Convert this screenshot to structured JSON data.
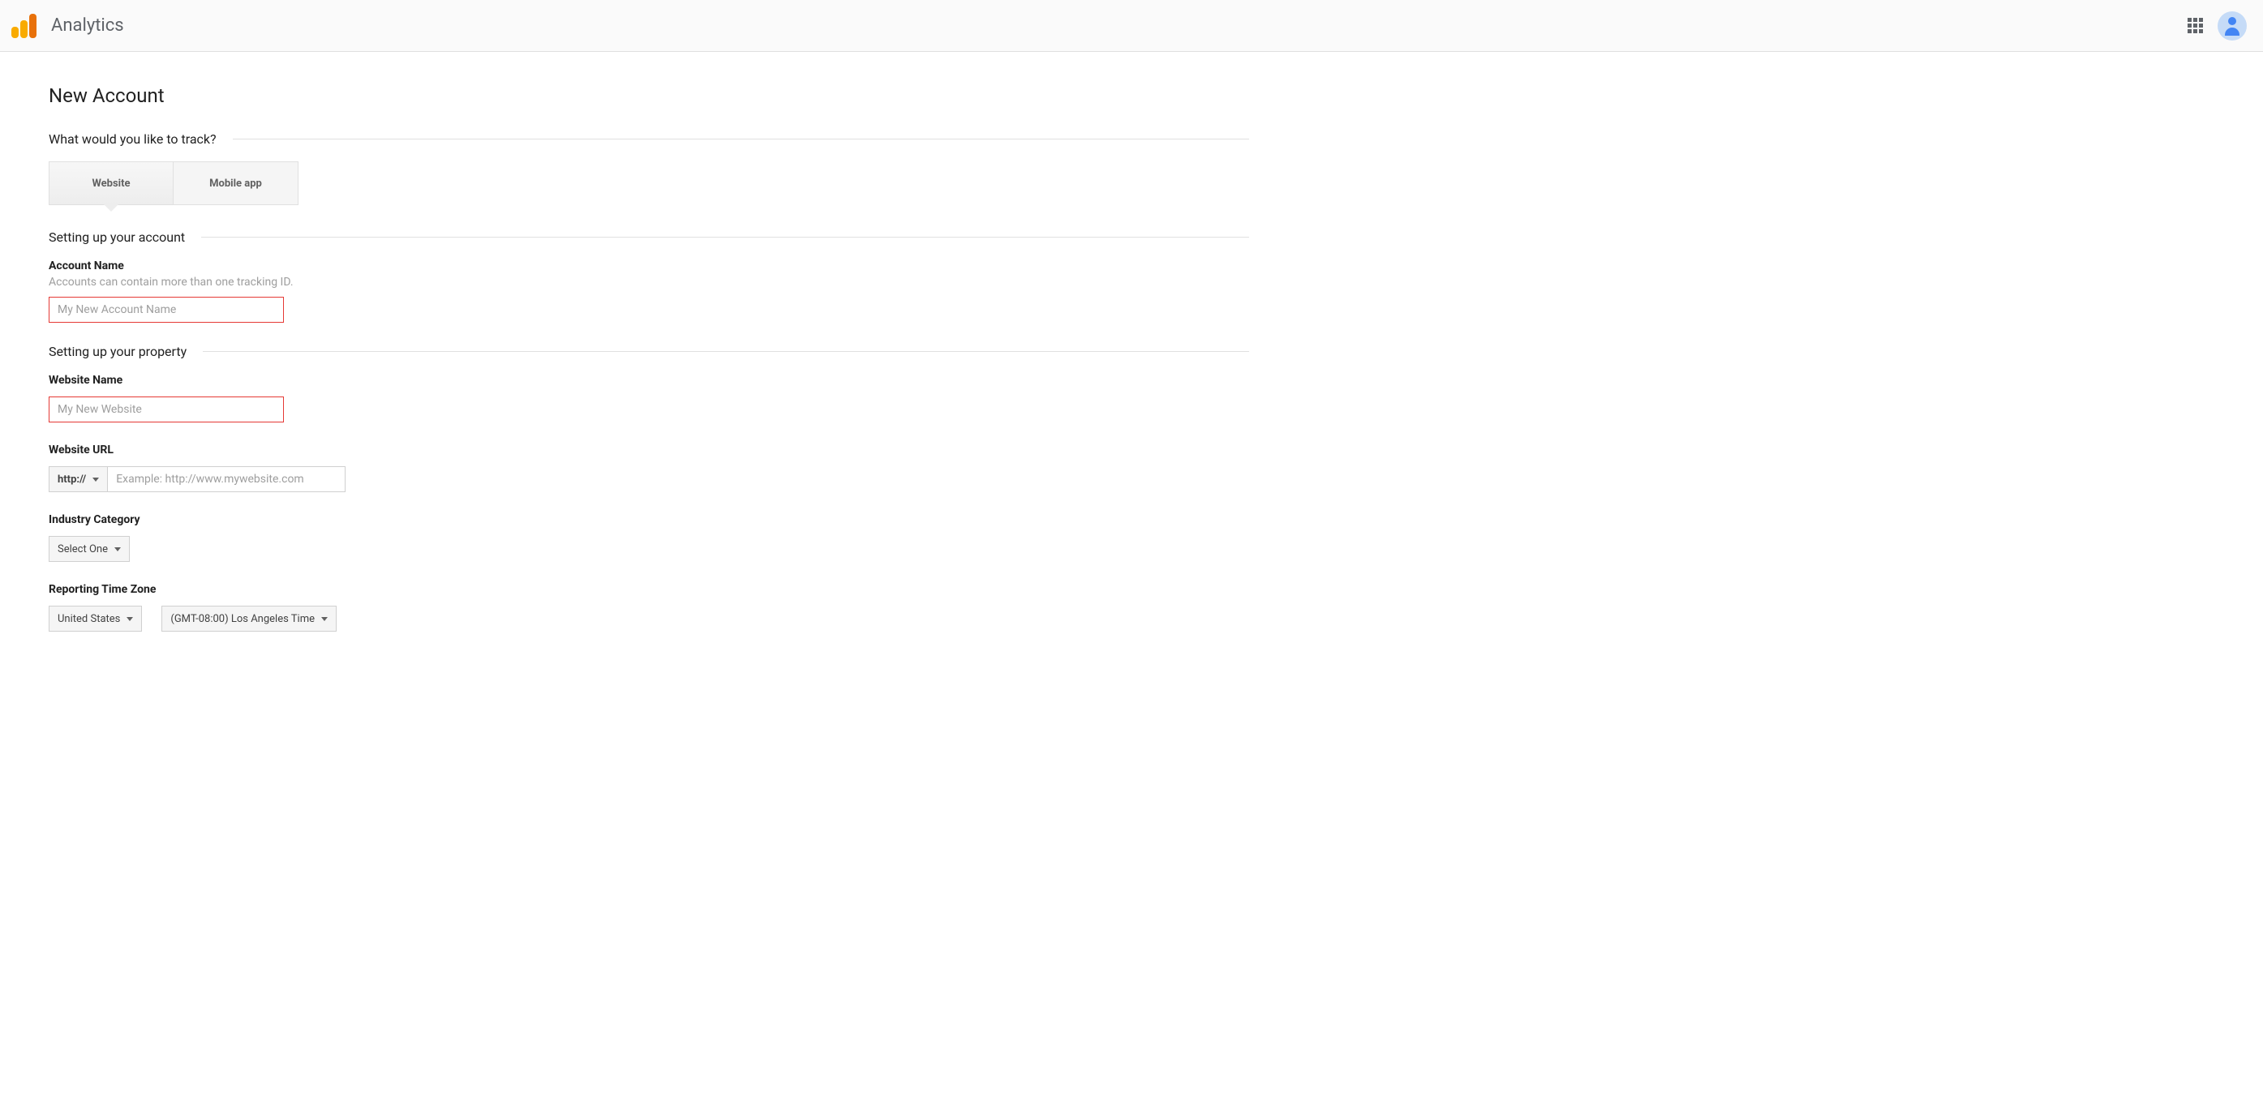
{
  "header": {
    "title": "Analytics"
  },
  "page": {
    "title": "New Account"
  },
  "sections": {
    "track": "What would you like to track?",
    "account": "Setting up your account",
    "property": "Setting up your property"
  },
  "tabs": {
    "website": "Website",
    "mobile": "Mobile app"
  },
  "fields": {
    "account_name": {
      "label": "Account Name",
      "hint": "Accounts can contain more than one tracking ID.",
      "placeholder": "My New Account Name",
      "value": ""
    },
    "website_name": {
      "label": "Website Name",
      "placeholder": "My New Website",
      "value": ""
    },
    "website_url": {
      "label": "Website URL",
      "protocol": "http://",
      "placeholder": "Example: http://www.mywebsite.com",
      "value": ""
    },
    "industry": {
      "label": "Industry Category",
      "value": "Select One"
    },
    "timezone": {
      "label": "Reporting Time Zone",
      "country": "United States",
      "tz": "(GMT-08:00) Los Angeles Time"
    }
  }
}
